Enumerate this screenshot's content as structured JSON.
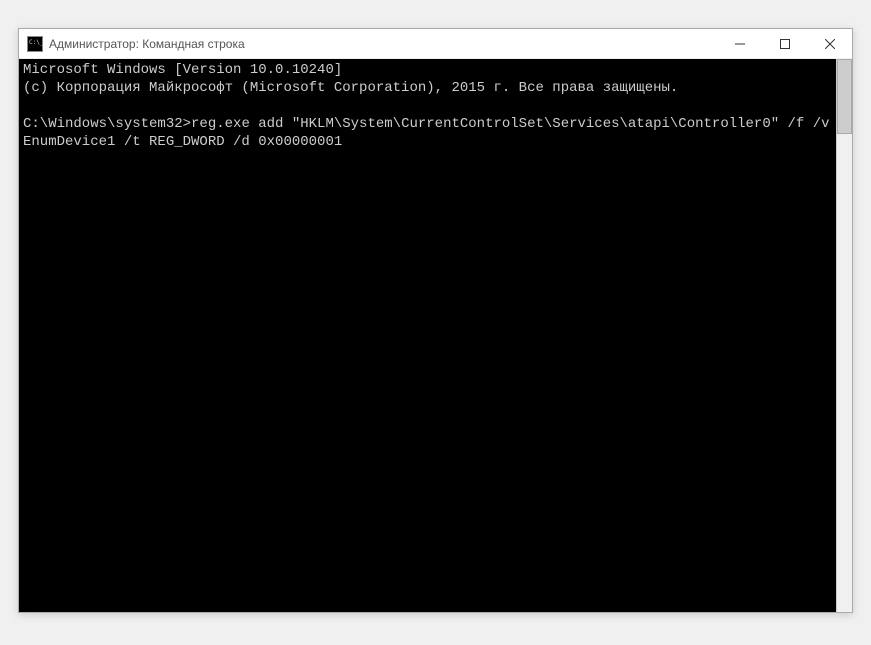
{
  "window": {
    "title": "Администратор: Командная строка"
  },
  "console": {
    "line1": "Microsoft Windows [Version 10.0.10240]",
    "line2": "(c) Корпорация Майкрософт (Microsoft Corporation), 2015 г. Все права защищены.",
    "prompt": "C:\\Windows\\system32>",
    "command": "reg.exe add \"HKLM\\System\\CurrentControlSet\\Services\\atapi\\Controller0\" /f /v EnumDevice1 /t REG_DWORD /d 0x00000001"
  }
}
